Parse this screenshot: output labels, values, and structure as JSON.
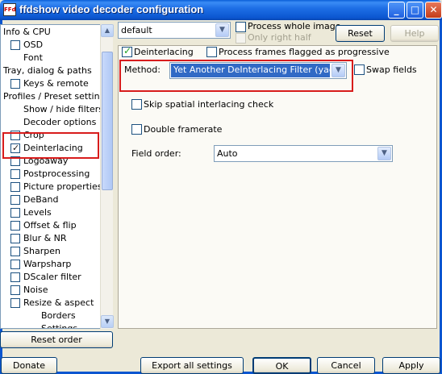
{
  "window": {
    "title": "ffdshow video decoder configuration",
    "icon_text": "FFd"
  },
  "tree": {
    "items": [
      {
        "label": "Info & CPU",
        "checkbox": false
      },
      {
        "label": "OSD",
        "checkbox": true,
        "checked": false
      },
      {
        "label": "Font",
        "checkbox": false
      },
      {
        "label": "Tray, dialog & paths",
        "checkbox": false
      },
      {
        "label": "Keys & remote",
        "checkbox": true,
        "checked": false
      },
      {
        "label": "Profiles / Preset settings",
        "checkbox": false
      },
      {
        "label": "Show / hide filters",
        "checkbox": false
      },
      {
        "label": "Decoder options",
        "checkbox": false
      },
      {
        "label": "Crop",
        "checkbox": true,
        "checked": false
      },
      {
        "label": "Deinterlacing",
        "checkbox": true,
        "checked": true
      },
      {
        "label": "Logoaway",
        "checkbox": true,
        "checked": false
      },
      {
        "label": "Postprocessing",
        "checkbox": true,
        "checked": false
      },
      {
        "label": "Picture properties",
        "checkbox": true,
        "checked": false
      },
      {
        "label": "DeBand",
        "checkbox": true,
        "checked": false
      },
      {
        "label": "Levels",
        "checkbox": true,
        "checked": false
      },
      {
        "label": "Offset & flip",
        "checkbox": true,
        "checked": false
      },
      {
        "label": "Blur & NR",
        "checkbox": true,
        "checked": false
      },
      {
        "label": "Sharpen",
        "checkbox": true,
        "checked": false
      },
      {
        "label": "Warpsharp",
        "checkbox": true,
        "checked": false
      },
      {
        "label": "DScaler filter",
        "checkbox": true,
        "checked": false
      },
      {
        "label": "Noise",
        "checkbox": true,
        "checked": false
      },
      {
        "label": "Resize & aspect",
        "checkbox": true,
        "checked": false
      },
      {
        "label": "Borders",
        "checkbox": false
      },
      {
        "label": "Settings",
        "checkbox": false
      }
    ]
  },
  "preset": {
    "value": "default"
  },
  "options": {
    "process_whole_image": "Process whole image",
    "only_right_half": "Only right half",
    "reset": "Reset",
    "help": "Help",
    "deinterlacing": "Deinterlacing",
    "process_progressive": "Process frames flagged as progressive",
    "method_label": "Method:",
    "method_value": "Yet Another DeInterlacing Filter (yadif)",
    "swap_fields": "Swap fields",
    "skip_spatial": "Skip spatial interlacing check",
    "double_framerate": "Double framerate",
    "field_order_label": "Field order:",
    "field_order_value": "Auto"
  },
  "buttons": {
    "reset_order": "Reset order",
    "donate": "Donate",
    "export_all": "Export all settings",
    "ok": "OK",
    "cancel": "Cancel",
    "apply": "Apply"
  },
  "colors": {
    "highlight": "#d81c1c",
    "selection": "#316ac5"
  }
}
